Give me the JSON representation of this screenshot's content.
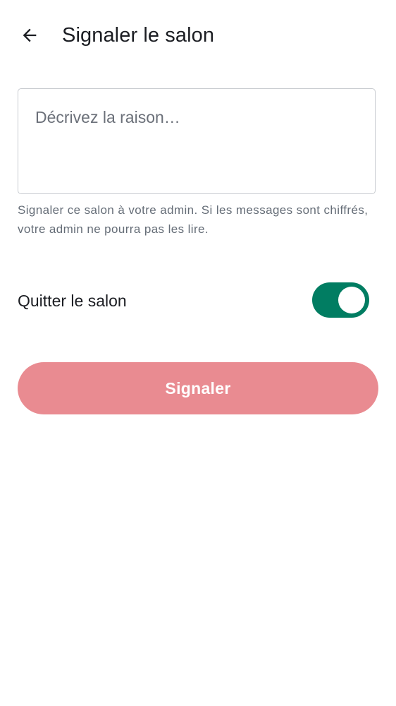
{
  "header": {
    "back_icon": "arrow-left-icon",
    "title": "Signaler le salon"
  },
  "reason_field": {
    "value": "",
    "placeholder": "Décrivez la raison…"
  },
  "helper_text": "Signaler ce salon à votre admin. Si les messages sont chiffrés, votre admin ne pourra pas les lire.",
  "leave_room": {
    "label": "Quitter le salon",
    "enabled": true
  },
  "submit": {
    "label": "Signaler",
    "enabled": false
  },
  "colors": {
    "accent": "#017d62",
    "critical_disabled": "#e98b91",
    "text_primary": "#1b1d22",
    "text_secondary": "#656d77"
  }
}
